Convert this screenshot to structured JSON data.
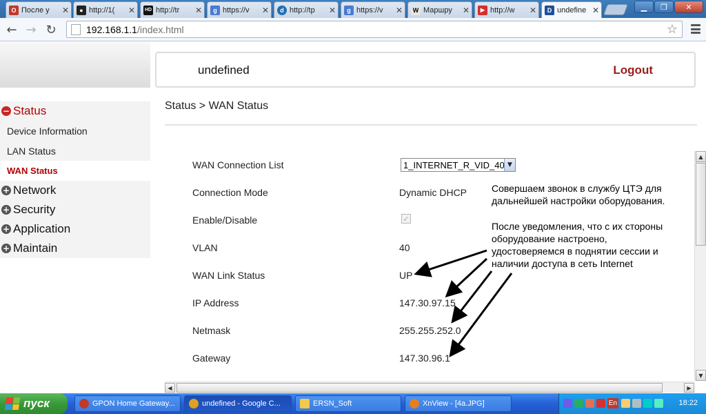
{
  "browser": {
    "tabs": [
      {
        "title": "После у",
        "icon": "opera-icon",
        "color": "#c0392b",
        "glyph": "O"
      },
      {
        "title": "http://1(",
        "icon": "spy-icon",
        "color": "#222222",
        "glyph": "●"
      },
      {
        "title": "http://tr",
        "icon": "hd-icon",
        "color": "#111111",
        "glyph": "HD"
      },
      {
        "title": "https://v",
        "icon": "google-icon",
        "color": "#4a7bd0",
        "glyph": "g"
      },
      {
        "title": "http://tp",
        "icon": "drupal-icon",
        "color": "#1f6fb5",
        "glyph": "d"
      },
      {
        "title": "https://v",
        "icon": "google-icon",
        "color": "#4a7bd0",
        "glyph": "g"
      },
      {
        "title": "Маршру",
        "icon": "wikipedia-icon",
        "color": "#e6e6e6",
        "glyph": "W"
      },
      {
        "title": "http://w",
        "icon": "youtube-icon",
        "color": "#d32f2f",
        "glyph": "▶"
      },
      {
        "title": "undefine",
        "icon": "router-icon",
        "color": "#1e4f9a",
        "glyph": "D"
      }
    ],
    "url_host": "192.168.1.1",
    "url_path": "/index.html"
  },
  "header": {
    "model": "undefined",
    "logout": "Logout"
  },
  "menu": {
    "status": "Status",
    "device_information": "Device Information",
    "lan_status": "LAN Status",
    "wan_status": "WAN Status",
    "network": "Network",
    "security": "Security",
    "application": "Application",
    "maintain": "Maintain"
  },
  "breadcrumb": "Status > WAN Status",
  "wan": {
    "connection_list_label": "WAN Connection List",
    "connection_list_value": "1_INTERNET_R_VID_40",
    "connection_mode_label": "Connection Mode",
    "connection_mode_value": "Dynamic DHCP",
    "enable_label": "Enable/Disable",
    "enabled": true,
    "vlan_label": "VLAN",
    "vlan_value": "40",
    "link_status_label": "WAN Link Status",
    "link_status_value": "UP",
    "ip_label": "IP Address",
    "ip_value": "147.30.97.15",
    "netmask_label": "Netmask",
    "netmask_value": "255.255.252.0",
    "gateway_label": "Gateway",
    "gateway_value": "147.30.96.1"
  },
  "annotation": {
    "line1": "Совершаем звонок в службу ЦТЭ для",
    "line2": "дальнейшей настройки оборудования.",
    "line3": "После уведомления, что с их стороны",
    "line4": "оборудование настроено,",
    "line5": "удостоверяемся в поднятии сессии и",
    "line6": "наличии доступа в сеть Internet"
  },
  "taskbar": {
    "start": "пуск",
    "items": [
      {
        "label": "GPON Home Gateway...",
        "icon": "opera-icon",
        "color": "#c0392b"
      },
      {
        "label": "undefined - Google C...",
        "icon": "chrome-icon",
        "color": "#e0a020"
      },
      {
        "label": "ERSN_Soft",
        "icon": "folder-icon",
        "color": "#f2c94c"
      },
      {
        "label": "XnView - [4a.JPG]",
        "icon": "xnview-icon",
        "color": "#e67e22"
      }
    ],
    "lang": "En",
    "clock": "18:22"
  }
}
